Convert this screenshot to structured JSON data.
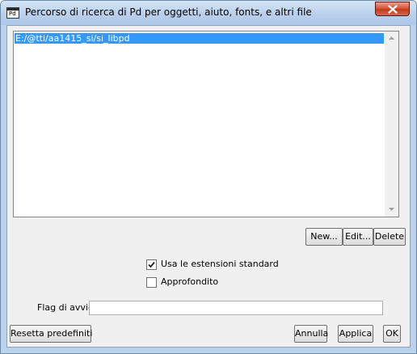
{
  "window": {
    "title": "Percorso di ricerca di Pd per oggetti, aiuto, fonts, e altri file",
    "icon_text": "Pd"
  },
  "path_list": {
    "items": [
      "E:/@tti/aa1415_si/si_libpd"
    ],
    "selected_index": 0
  },
  "list_actions": {
    "new_label": "New...",
    "edit_label": "Edit...",
    "delete_label": "Delete"
  },
  "options": {
    "standard_extensions_label": "Usa le estensioni standard",
    "standard_extensions_checked": true,
    "verbose_label": "Approfondito",
    "verbose_checked": false
  },
  "startup_flags": {
    "label": "Flag di avvio",
    "value": ""
  },
  "footer": {
    "reset_label": "Resetta predefiniti",
    "cancel_label": "Annulla",
    "apply_label": "Applica",
    "ok_label": "OK"
  },
  "colors": {
    "selection": "#3399ff",
    "frame": "#bcd1ea",
    "close_button": "#c33a1f"
  }
}
